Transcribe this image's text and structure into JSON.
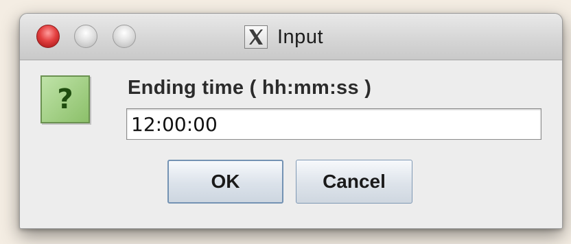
{
  "window": {
    "title": "Input",
    "title_icon": "x11-icon",
    "title_icon_glyph": "X"
  },
  "dialog": {
    "icon": "question-icon",
    "icon_glyph": "?",
    "prompt": "Ending time ( hh:mm:ss )",
    "input_value": "12:00:00"
  },
  "buttons": {
    "ok_label": "OK",
    "cancel_label": "Cancel"
  }
}
